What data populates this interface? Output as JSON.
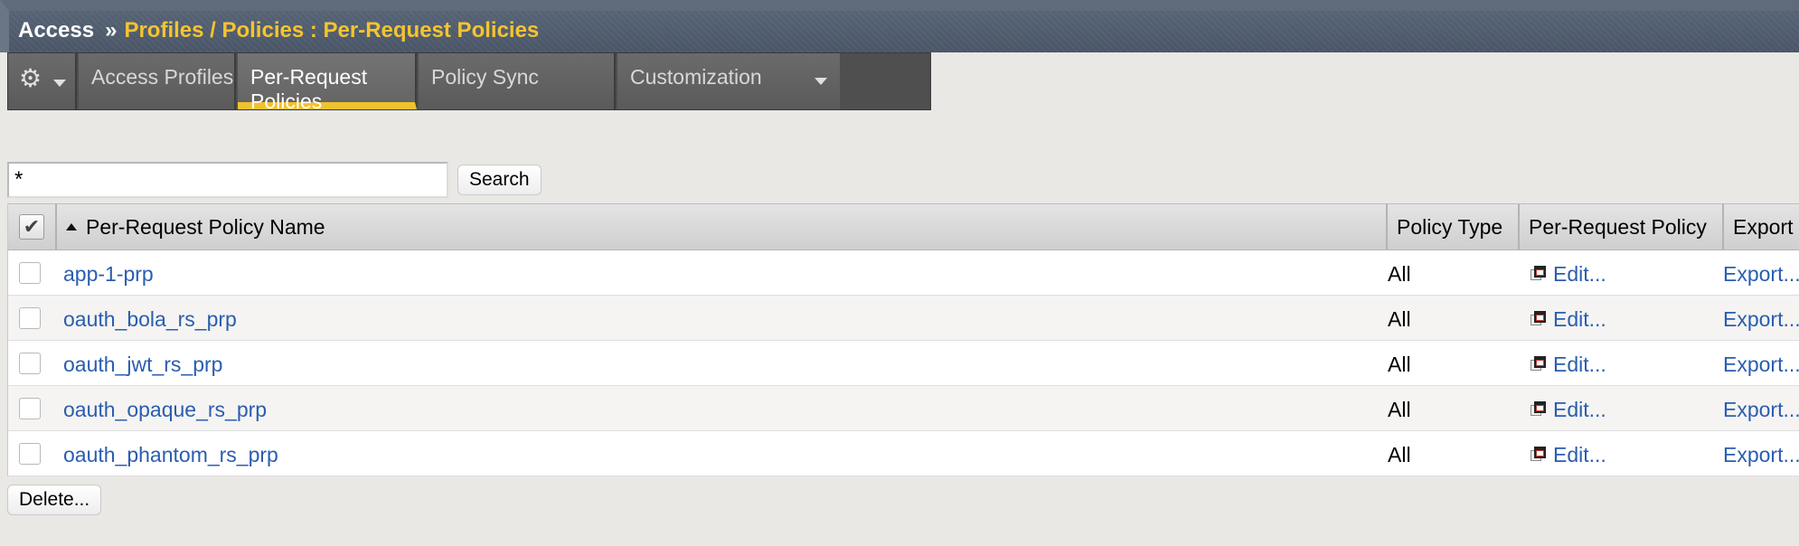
{
  "breadcrumb": {
    "root": "Access",
    "separator": "»",
    "current": "Profiles / Policies : Per-Request Policies"
  },
  "tabs": [
    {
      "label": "Access Profiles",
      "active": false
    },
    {
      "label": "Per-Request Policies",
      "active": true
    },
    {
      "label": "Policy Sync",
      "active": false
    },
    {
      "label": "Customization",
      "active": false,
      "has_dropdown": true
    }
  ],
  "icons": {
    "settings": "gear-icon",
    "edit": "policy-editor-icon",
    "sort": "sort-ascending-icon"
  },
  "search": {
    "value": "*",
    "button_label": "Search"
  },
  "table": {
    "columns": [
      "Per-Request Policy Name",
      "Policy Type",
      "Per-Request Policy",
      "Export"
    ],
    "rows": [
      {
        "name": "app-1-prp",
        "type": "All",
        "edit": "Edit...",
        "export": "Export..."
      },
      {
        "name": "oauth_bola_rs_prp",
        "type": "All",
        "edit": "Edit...",
        "export": "Export..."
      },
      {
        "name": "oauth_jwt_rs_prp",
        "type": "All",
        "edit": "Edit...",
        "export": "Export..."
      },
      {
        "name": "oauth_opaque_rs_prp",
        "type": "All",
        "edit": "Edit...",
        "export": "Export..."
      },
      {
        "name": "oauth_phantom_rs_prp",
        "type": "All",
        "edit": "Edit...",
        "export": "Export..."
      }
    ]
  },
  "actions": {
    "delete_label": "Delete..."
  },
  "colors": {
    "breadcrumb_bg": "#566375",
    "breadcrumb_current": "#f4c430",
    "active_tab_underline": "#f2c12e",
    "link": "#2a5db0"
  }
}
